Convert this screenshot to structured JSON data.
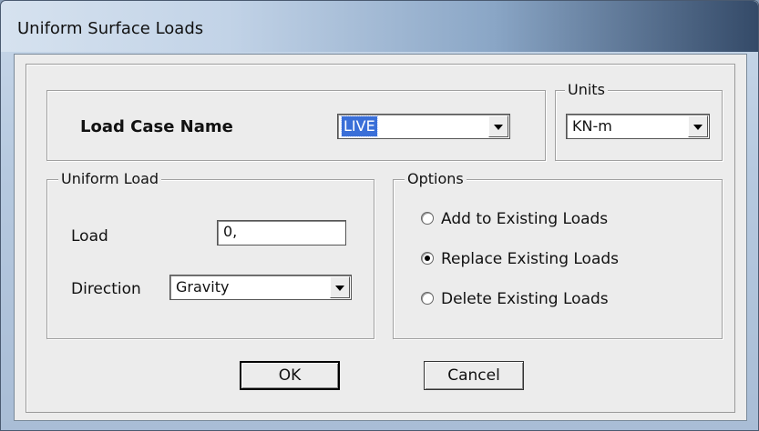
{
  "window": {
    "title": "Uniform Surface Loads"
  },
  "load_case": {
    "label": "Load Case Name",
    "value": "LIVE"
  },
  "units": {
    "legend": "Units",
    "value": "KN-m"
  },
  "uniform_load": {
    "legend": "Uniform Load",
    "load_label": "Load",
    "load_value": "0,",
    "direction_label": "Direction",
    "direction_value": "Gravity"
  },
  "options": {
    "legend": "Options",
    "items": [
      {
        "label": "Add to Existing Loads",
        "checked": false
      },
      {
        "label": "Replace Existing Loads",
        "checked": true
      },
      {
        "label": "Delete Existing Loads",
        "checked": false
      }
    ]
  },
  "buttons": {
    "ok": "OK",
    "cancel": "Cancel"
  }
}
